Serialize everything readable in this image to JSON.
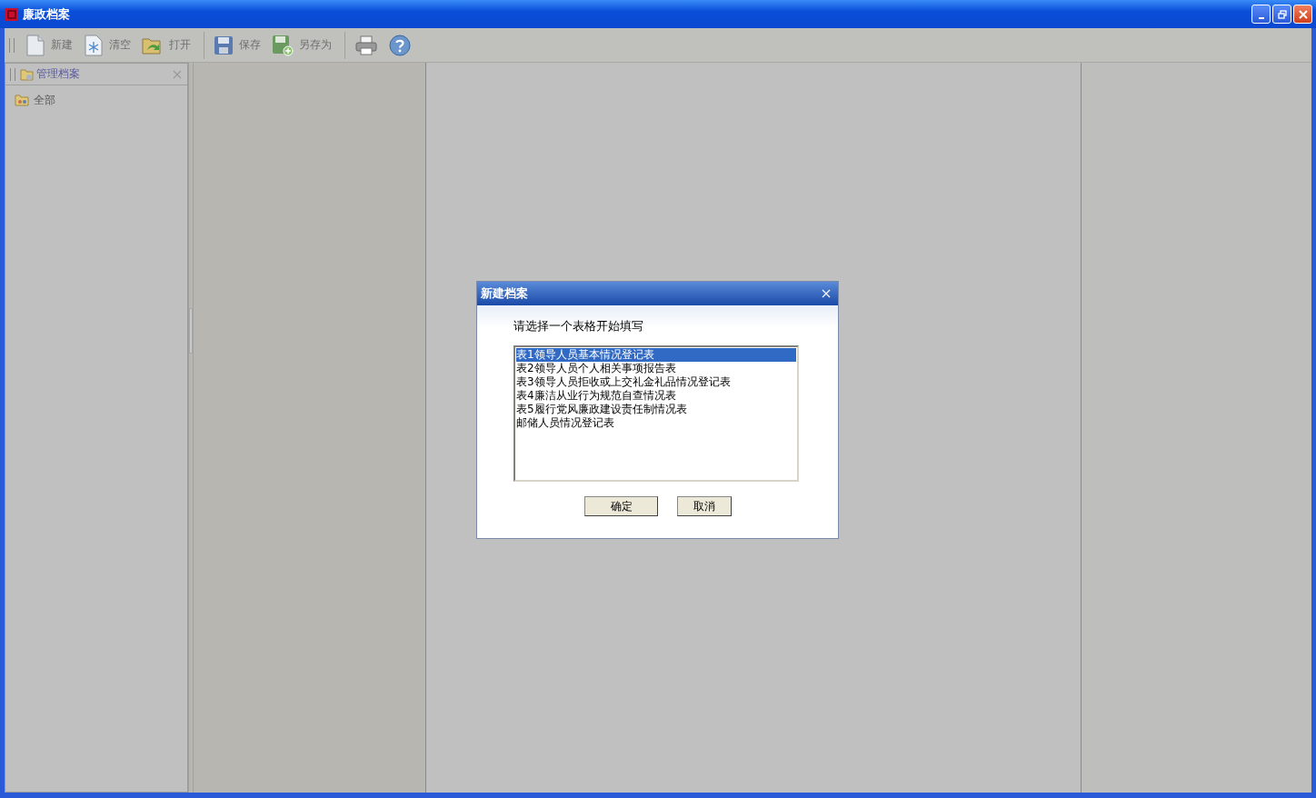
{
  "window": {
    "title": "廉政档案"
  },
  "toolbar": {
    "groups": [
      [
        {
          "kind": "new",
          "label": "新建"
        },
        {
          "kind": "clear",
          "label": "清空"
        },
        {
          "kind": "open",
          "label": "打开"
        }
      ],
      [
        {
          "kind": "save",
          "label": "保存"
        },
        {
          "kind": "save_as",
          "label": "另存为"
        }
      ],
      [
        {
          "kind": "print"
        },
        {
          "kind": "help"
        }
      ]
    ]
  },
  "panel": {
    "title": "管理档案",
    "items": [
      {
        "label": "全部"
      }
    ]
  },
  "dialog": {
    "title": "新建档案",
    "prompt": "请选择一个表格开始填写",
    "options": [
      {
        "label": "表1领导人员基本情况登记表",
        "selected": true
      },
      {
        "label": "表2领导人员个人相关事项报告表",
        "selected": false
      },
      {
        "label": "表3领导人员拒收或上交礼金礼品情况登记表",
        "selected": false
      },
      {
        "label": "表4廉洁从业行为规范自查情况表",
        "selected": false
      },
      {
        "label": "表5履行党风廉政建设责任制情况表",
        "selected": false
      },
      {
        "label": "邮储人员情况登记表",
        "selected": false
      }
    ],
    "buttons": [
      "确定",
      "取消"
    ]
  }
}
